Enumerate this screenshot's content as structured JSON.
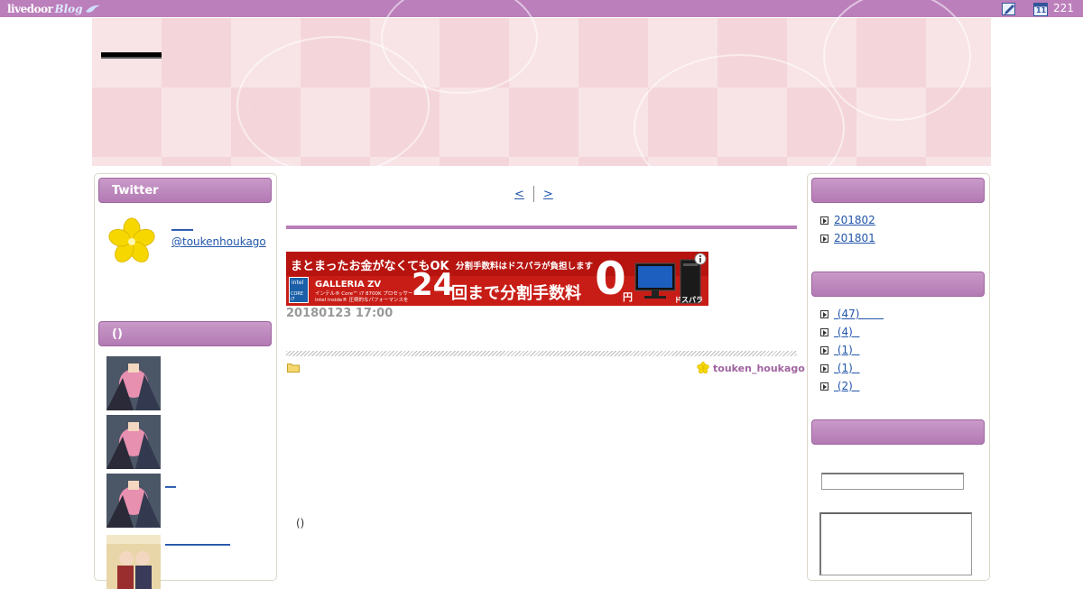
{
  "topbar": {
    "logo_text": "livedoor",
    "logo_blog": "Blog",
    "edit_icon": "edit-icon",
    "calendar_icon": "calendar-icon",
    "calendar_day": "11",
    "count": "221"
  },
  "sidebar_left": {
    "twitter_heading": "Twitter",
    "twitter_name": "____",
    "twitter_handle": "@toukenhoukago",
    "section2_heading": "()",
    "thumbnails": [
      {
        "link": ""
      },
      {
        "link": ""
      },
      {
        "link": "__"
      },
      {
        "link": "____________"
      }
    ]
  },
  "main": {
    "prev_label": "<",
    "next_label": ">",
    "ad": {
      "line1_small": "まとまったお金がなくてもOK",
      "line1_tail": "分割手数料はドスパラが負担します",
      "brand": "GALLERIA ZV",
      "spec1": "インテル® Core™ i7 8700K プロセッサー",
      "spec2": "Intel Inside® 圧倒的なパフォーマンスを",
      "big_num": "24",
      "big_text": "回まで分割手数料",
      "zero": "0",
      "yen": "円",
      "intel_label": "intel",
      "intel_sub": "CORE i7",
      "store": "ドスパラ"
    },
    "post_date": "20180123 17:00",
    "author": "touken_houkago",
    "paren": "()"
  },
  "sidebar_right": {
    "archives": [
      {
        "label": "201802"
      },
      {
        "label": "201801"
      }
    ],
    "categories": [
      {
        "label": " (47)       "
      },
      {
        "label": " (4)  "
      },
      {
        "label": " (1)  "
      },
      {
        "label": " (1)  "
      },
      {
        "label": " (2)  "
      }
    ]
  },
  "colors": {
    "accent": "#bb7fbb",
    "link": "#2255aa",
    "ad_red": "#c81d16"
  }
}
